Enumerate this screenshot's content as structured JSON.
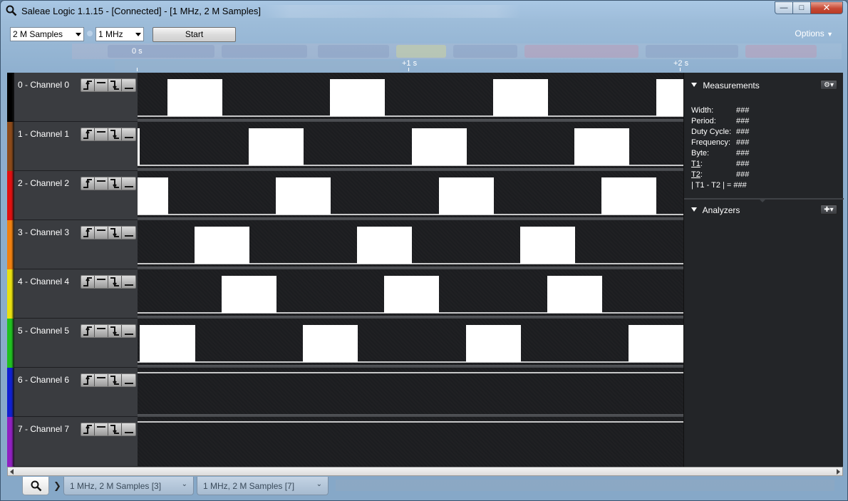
{
  "window": {
    "title": "Saleae Logic 1.1.15 - [Connected] - [1 MHz, 2 M Samples]"
  },
  "toolbar": {
    "samples_value": "2 M Samples",
    "rate_value": "1 MHz",
    "start_label": "Start",
    "options_label": "Options"
  },
  "timeline": {
    "t0": "0 s",
    "t1": "+1 s",
    "t2": "+2 s"
  },
  "channels": [
    {
      "name": "0 - Channel 0",
      "color": "#000000"
    },
    {
      "name": "1 - Channel 1",
      "color": "#8b4a1a"
    },
    {
      "name": "2 - Channel 2",
      "color": "#e01010"
    },
    {
      "name": "3 - Channel 3",
      "color": "#f08010"
    },
    {
      "name": "4 - Channel 4",
      "color": "#e8e010"
    },
    {
      "name": "5 - Channel 5",
      "color": "#20c020"
    },
    {
      "name": "6 - Channel 6",
      "color": "#1020d0"
    },
    {
      "name": "7 - Channel 7",
      "color": "#9020c0"
    }
  ],
  "measurements": {
    "title": "Measurements",
    "rows": [
      {
        "key": "Width:",
        "value": "###"
      },
      {
        "key": "Period:",
        "value": "###"
      },
      {
        "key": "Duty Cycle:",
        "value": "###"
      },
      {
        "key": "Frequency:",
        "value": "###"
      },
      {
        "key": "Byte:",
        "value": "###"
      },
      {
        "key": "T1",
        "value": "###"
      },
      {
        "key": "T2",
        "value": "###"
      },
      {
        "key": "| T1 - T2 | =",
        "value": "###"
      }
    ]
  },
  "analyzers": {
    "title": "Analyzers"
  },
  "bottom_tabs": [
    {
      "label": "1 MHz, 2 M Samples [3]"
    },
    {
      "label": "1 MHz, 2 M Samples [7]"
    }
  ]
}
